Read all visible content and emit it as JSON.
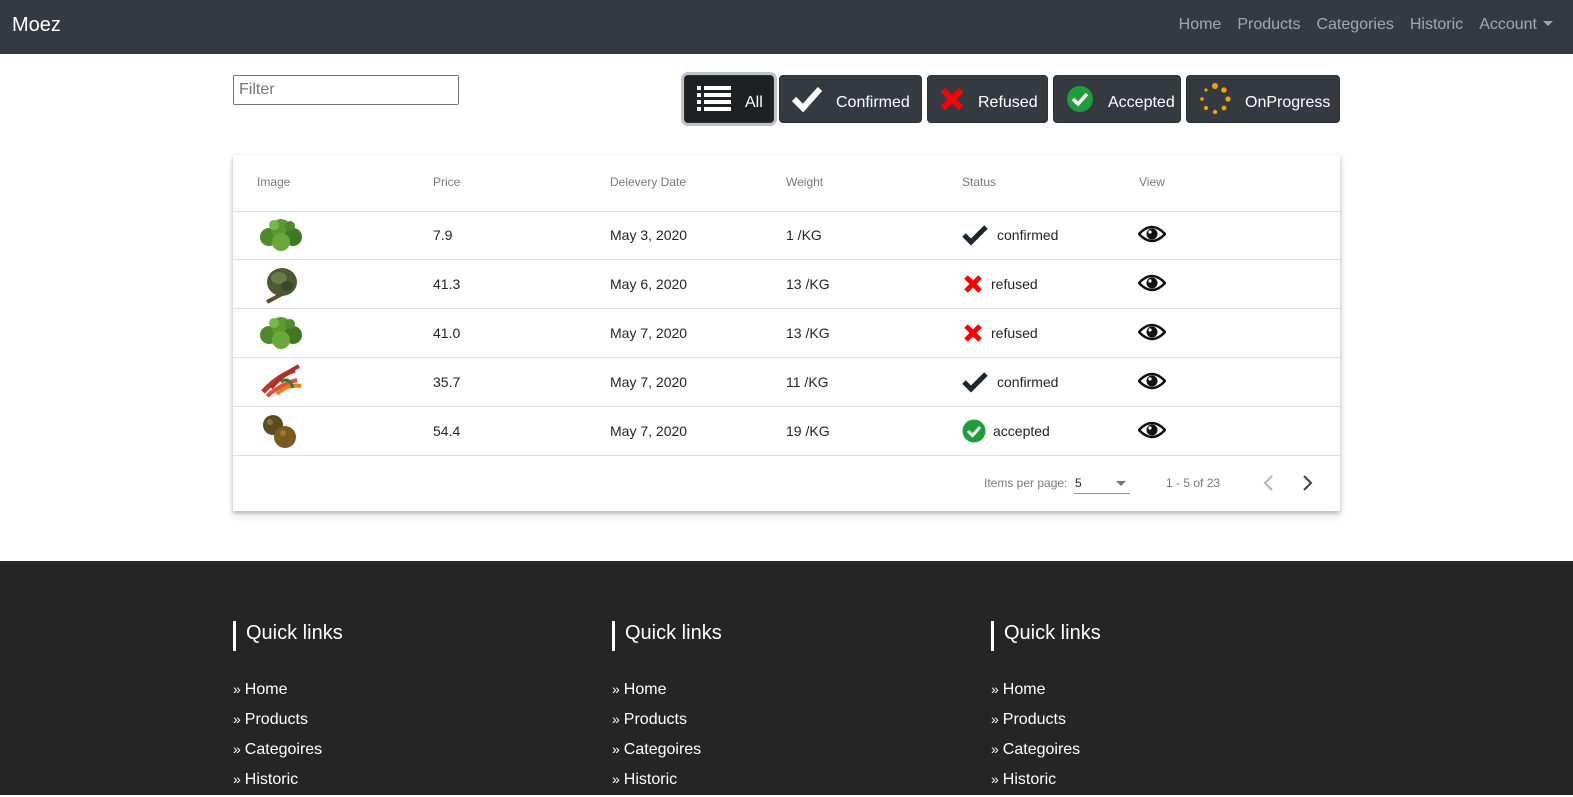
{
  "navbar": {
    "brand": "Moez",
    "links": [
      "Home",
      "Products",
      "Categories",
      "Historic",
      "Account"
    ]
  },
  "filter": {
    "placeholder": "Filter",
    "value": ""
  },
  "status_buttons": [
    {
      "label": "All",
      "icon": "list-icon",
      "active": true
    },
    {
      "label": "Confirmed",
      "icon": "check-icon"
    },
    {
      "label": "Refused",
      "icon": "cross-icon"
    },
    {
      "label": "Accepted",
      "icon": "check-circle-icon"
    },
    {
      "label": "OnProgress",
      "icon": "spinner-icon"
    }
  ],
  "table": {
    "columns": [
      "Image",
      "Price",
      "Delevery Date",
      "Weight",
      "Status",
      "View"
    ],
    "rows": [
      {
        "image": "parsley",
        "price": "7.9",
        "date": "May 3, 2020",
        "weight": "1 /KG",
        "status": "confirmed"
      },
      {
        "image": "artichoke",
        "price": "41.3",
        "date": "May 6, 2020",
        "weight": "13 /KG",
        "status": "refused"
      },
      {
        "image": "parsley",
        "price": "41.0",
        "date": "May 7, 2020",
        "weight": "13 /KG",
        "status": "refused"
      },
      {
        "image": "peppers",
        "price": "35.7",
        "date": "May 7, 2020",
        "weight": "11 /KG",
        "status": "confirmed"
      },
      {
        "image": "potatoes",
        "price": "54.4",
        "date": "May 7, 2020",
        "weight": "19 /KG",
        "status": "accepted"
      }
    ]
  },
  "paginator": {
    "items_per_page_label": "Items per page:",
    "items_per_page": "5",
    "range": "1 - 5 of 23"
  },
  "footer": {
    "columns": [
      {
        "title": "Quick links",
        "links": [
          "Home",
          "Products",
          "Categoires",
          "Historic"
        ]
      },
      {
        "title": "Quick links",
        "links": [
          "Home",
          "Products",
          "Categoires",
          "Historic"
        ]
      },
      {
        "title": "Quick links",
        "links": [
          "Home",
          "Products",
          "Categoires",
          "Historic"
        ]
      }
    ]
  },
  "colors": {
    "navbar": "#343a40",
    "footer": "#252525",
    "refused": "#ff0000",
    "accepted": "#1e9e3a",
    "progress": "#f0a500"
  }
}
